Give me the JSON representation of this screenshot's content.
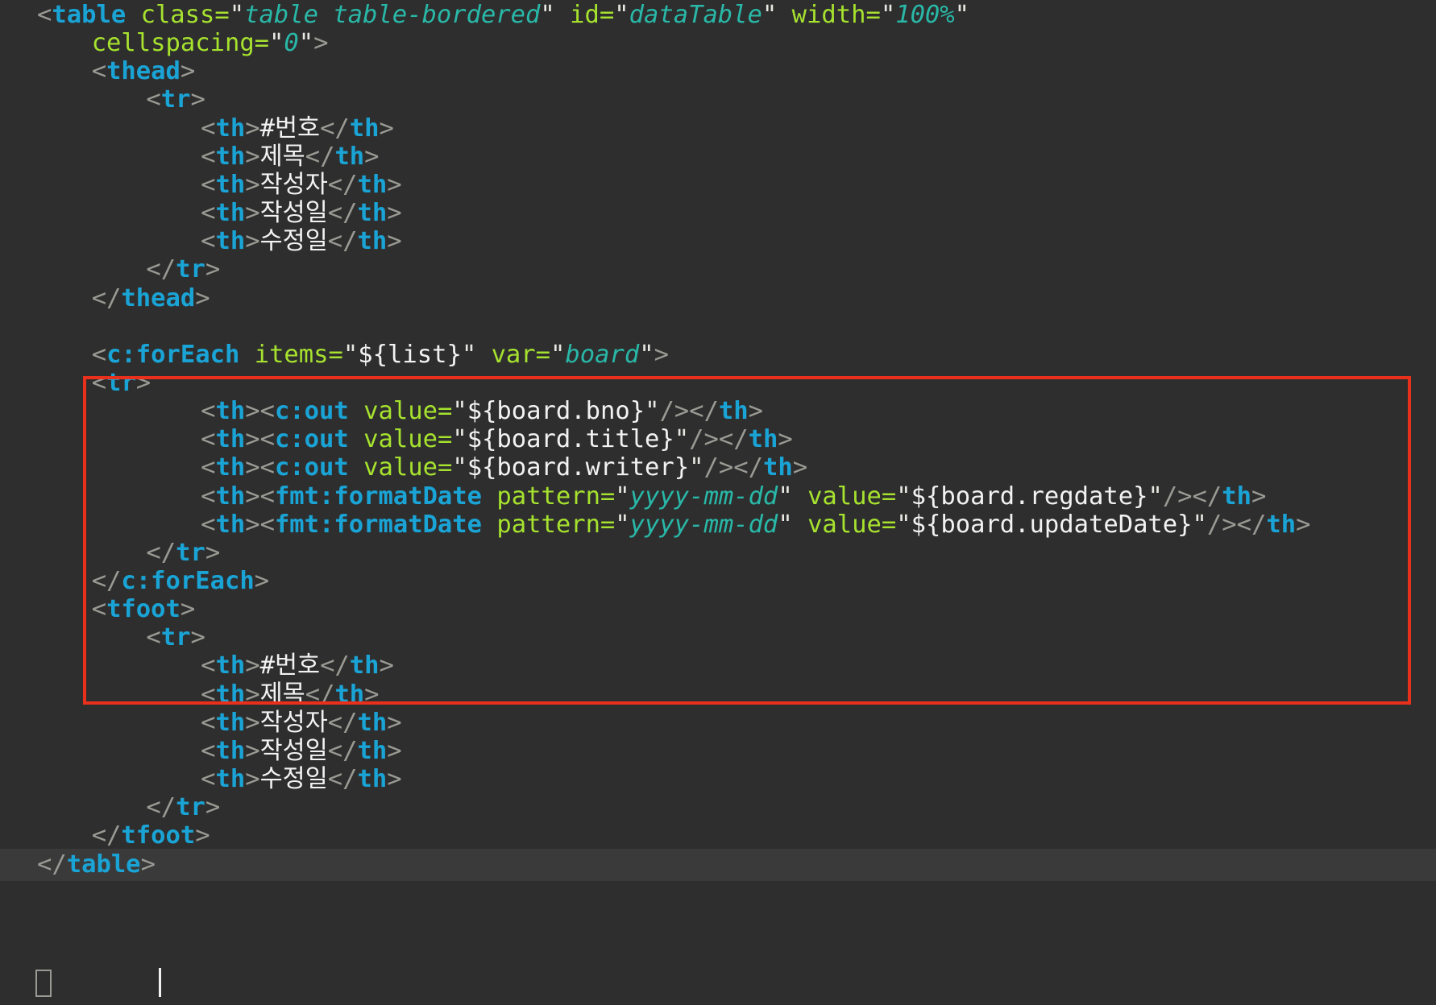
{
  "editor": {
    "language": "JSP / HTML",
    "colors": {
      "background": "#2e2e2e",
      "current_line": "#3a3a3a",
      "tag": "#1aa4d6",
      "attribute": "#a6e22e",
      "string": "#29b8a8",
      "punctuation": "#9a9a94",
      "text": "#f2f2f2",
      "highlight_box": "#e8301c"
    },
    "lines": [
      {
        "indent": 1,
        "tokens": [
          [
            "p",
            "<"
          ],
          [
            "t",
            "table"
          ],
          [
            "x",
            " "
          ],
          [
            "a",
            "class="
          ],
          [
            "q",
            "\""
          ],
          [
            "s",
            "table table-bordered"
          ],
          [
            "q",
            "\""
          ],
          [
            "x",
            " "
          ],
          [
            "a",
            "id="
          ],
          [
            "q",
            "\""
          ],
          [
            "s",
            "dataTable"
          ],
          [
            "q",
            "\""
          ],
          [
            "x",
            " "
          ],
          [
            "a",
            "width="
          ],
          [
            "q",
            "\""
          ],
          [
            "s",
            "100%"
          ],
          [
            "q",
            "\""
          ]
        ]
      },
      {
        "indent": 2,
        "tokens": [
          [
            "a",
            "cellspacing="
          ],
          [
            "q",
            "\""
          ],
          [
            "s",
            "0"
          ],
          [
            "q",
            "\""
          ],
          [
            "p",
            ">"
          ]
        ]
      },
      {
        "indent": 2,
        "tokens": [
          [
            "p",
            "<"
          ],
          [
            "t",
            "thead"
          ],
          [
            "p",
            ">"
          ]
        ]
      },
      {
        "indent": 3,
        "tokens": [
          [
            "p",
            "<"
          ],
          [
            "t",
            "tr"
          ],
          [
            "p",
            ">"
          ]
        ]
      },
      {
        "indent": 4,
        "tokens": [
          [
            "p",
            "<"
          ],
          [
            "t",
            "th"
          ],
          [
            "p",
            ">"
          ],
          [
            "x",
            "#번호"
          ],
          [
            "p",
            "</"
          ],
          [
            "t",
            "th"
          ],
          [
            "p",
            ">"
          ]
        ]
      },
      {
        "indent": 4,
        "tokens": [
          [
            "p",
            "<"
          ],
          [
            "t",
            "th"
          ],
          [
            "p",
            ">"
          ],
          [
            "x",
            "제목"
          ],
          [
            "p",
            "</"
          ],
          [
            "t",
            "th"
          ],
          [
            "p",
            ">"
          ]
        ]
      },
      {
        "indent": 4,
        "tokens": [
          [
            "p",
            "<"
          ],
          [
            "t",
            "th"
          ],
          [
            "p",
            ">"
          ],
          [
            "x",
            "작성자"
          ],
          [
            "p",
            "</"
          ],
          [
            "t",
            "th"
          ],
          [
            "p",
            ">"
          ]
        ]
      },
      {
        "indent": 4,
        "tokens": [
          [
            "p",
            "<"
          ],
          [
            "t",
            "th"
          ],
          [
            "p",
            ">"
          ],
          [
            "x",
            "작성일"
          ],
          [
            "p",
            "</"
          ],
          [
            "t",
            "th"
          ],
          [
            "p",
            ">"
          ]
        ]
      },
      {
        "indent": 4,
        "tokens": [
          [
            "p",
            "<"
          ],
          [
            "t",
            "th"
          ],
          [
            "p",
            ">"
          ],
          [
            "x",
            "수정일"
          ],
          [
            "p",
            "</"
          ],
          [
            "t",
            "th"
          ],
          [
            "p",
            ">"
          ]
        ]
      },
      {
        "indent": 3,
        "tokens": [
          [
            "p",
            "</"
          ],
          [
            "t",
            "tr"
          ],
          [
            "p",
            ">"
          ]
        ]
      },
      {
        "indent": 2,
        "tokens": [
          [
            "p",
            "</"
          ],
          [
            "t",
            "thead"
          ],
          [
            "p",
            ">"
          ]
        ]
      },
      {
        "indent": 0,
        "tokens": []
      },
      {
        "indent": 2,
        "tokens": [
          [
            "p",
            "<"
          ],
          [
            "t",
            "c:forEach"
          ],
          [
            "x",
            " "
          ],
          [
            "a",
            "items="
          ],
          [
            "q",
            "\""
          ],
          [
            "x",
            "${list}"
          ],
          [
            "q",
            "\""
          ],
          [
            "x",
            " "
          ],
          [
            "a",
            "var="
          ],
          [
            "q",
            "\""
          ],
          [
            "s",
            "board"
          ],
          [
            "q",
            "\""
          ],
          [
            "p",
            ">"
          ]
        ]
      },
      {
        "indent": 2,
        "tokens": [
          [
            "p",
            "<"
          ],
          [
            "t",
            "tr"
          ],
          [
            "p",
            ">"
          ]
        ]
      },
      {
        "indent": 4,
        "tokens": [
          [
            "p",
            "<"
          ],
          [
            "t",
            "th"
          ],
          [
            "p",
            "><"
          ],
          [
            "t",
            "c:out"
          ],
          [
            "x",
            " "
          ],
          [
            "a",
            "value="
          ],
          [
            "q",
            "\""
          ],
          [
            "x",
            "${board.bno}"
          ],
          [
            "q",
            "\""
          ],
          [
            "p",
            "/></"
          ],
          [
            "t",
            "th"
          ],
          [
            "p",
            ">"
          ]
        ]
      },
      {
        "indent": 4,
        "tokens": [
          [
            "p",
            "<"
          ],
          [
            "t",
            "th"
          ],
          [
            "p",
            "><"
          ],
          [
            "t",
            "c:out"
          ],
          [
            "x",
            " "
          ],
          [
            "a",
            "value="
          ],
          [
            "q",
            "\""
          ],
          [
            "x",
            "${board.title}"
          ],
          [
            "q",
            "\""
          ],
          [
            "p",
            "/></"
          ],
          [
            "t",
            "th"
          ],
          [
            "p",
            ">"
          ]
        ]
      },
      {
        "indent": 4,
        "tokens": [
          [
            "p",
            "<"
          ],
          [
            "t",
            "th"
          ],
          [
            "p",
            "><"
          ],
          [
            "t",
            "c:out"
          ],
          [
            "x",
            " "
          ],
          [
            "a",
            "value="
          ],
          [
            "q",
            "\""
          ],
          [
            "x",
            "${board.writer}"
          ],
          [
            "q",
            "\""
          ],
          [
            "p",
            "/></"
          ],
          [
            "t",
            "th"
          ],
          [
            "p",
            ">"
          ]
        ]
      },
      {
        "indent": 4,
        "tokens": [
          [
            "p",
            "<"
          ],
          [
            "t",
            "th"
          ],
          [
            "p",
            "><"
          ],
          [
            "t",
            "fmt:formatDate"
          ],
          [
            "x",
            " "
          ],
          [
            "a",
            "pattern="
          ],
          [
            "q",
            "\""
          ],
          [
            "s",
            "yyyy-mm-dd"
          ],
          [
            "q",
            "\""
          ],
          [
            "x",
            " "
          ],
          [
            "a",
            "value="
          ],
          [
            "q",
            "\""
          ],
          [
            "x",
            "${board.regdate}"
          ],
          [
            "q",
            "\""
          ],
          [
            "p",
            "/></"
          ],
          [
            "t",
            "th"
          ],
          [
            "p",
            ">"
          ]
        ]
      },
      {
        "indent": 4,
        "tokens": [
          [
            "p",
            "<"
          ],
          [
            "t",
            "th"
          ],
          [
            "p",
            "><"
          ],
          [
            "t",
            "fmt:formatDate"
          ],
          [
            "x",
            " "
          ],
          [
            "a",
            "pattern="
          ],
          [
            "q",
            "\""
          ],
          [
            "s",
            "yyyy-mm-dd"
          ],
          [
            "q",
            "\""
          ],
          [
            "x",
            " "
          ],
          [
            "a",
            "value="
          ],
          [
            "q",
            "\""
          ],
          [
            "x",
            "${board.updateDate}"
          ],
          [
            "q",
            "\""
          ],
          [
            "p",
            "/></"
          ],
          [
            "t",
            "th"
          ],
          [
            "p",
            ">"
          ]
        ]
      },
      {
        "indent": 3,
        "tokens": [
          [
            "p",
            "</"
          ],
          [
            "t",
            "tr"
          ],
          [
            "p",
            ">"
          ]
        ]
      },
      {
        "indent": 2,
        "tokens": [
          [
            "p",
            "</"
          ],
          [
            "t",
            "c:forEach"
          ],
          [
            "p",
            ">"
          ]
        ]
      },
      {
        "indent": 2,
        "tokens": [
          [
            "p",
            "<"
          ],
          [
            "t",
            "tfoot"
          ],
          [
            "p",
            ">"
          ]
        ]
      },
      {
        "indent": 3,
        "tokens": [
          [
            "p",
            "<"
          ],
          [
            "t",
            "tr"
          ],
          [
            "p",
            ">"
          ]
        ]
      },
      {
        "indent": 4,
        "tokens": [
          [
            "p",
            "<"
          ],
          [
            "t",
            "th"
          ],
          [
            "p",
            ">"
          ],
          [
            "x",
            "#번호"
          ],
          [
            "p",
            "</"
          ],
          [
            "t",
            "th"
          ],
          [
            "p",
            ">"
          ]
        ]
      },
      {
        "indent": 4,
        "tokens": [
          [
            "p",
            "<"
          ],
          [
            "t",
            "th"
          ],
          [
            "p",
            ">"
          ],
          [
            "x",
            "제목"
          ],
          [
            "p",
            "</"
          ],
          [
            "t",
            "th"
          ],
          [
            "p",
            ">"
          ]
        ]
      },
      {
        "indent": 4,
        "tokens": [
          [
            "p",
            "<"
          ],
          [
            "t",
            "th"
          ],
          [
            "p",
            ">"
          ],
          [
            "x",
            "작성자"
          ],
          [
            "p",
            "</"
          ],
          [
            "t",
            "th"
          ],
          [
            "p",
            ">"
          ]
        ]
      },
      {
        "indent": 4,
        "tokens": [
          [
            "p",
            "<"
          ],
          [
            "t",
            "th"
          ],
          [
            "p",
            ">"
          ],
          [
            "x",
            "작성일"
          ],
          [
            "p",
            "</"
          ],
          [
            "t",
            "th"
          ],
          [
            "p",
            ">"
          ]
        ]
      },
      {
        "indent": 4,
        "tokens": [
          [
            "p",
            "<"
          ],
          [
            "t",
            "th"
          ],
          [
            "p",
            ">"
          ],
          [
            "x",
            "수정일"
          ],
          [
            "p",
            "</"
          ],
          [
            "t",
            "th"
          ],
          [
            "p",
            ">"
          ]
        ]
      },
      {
        "indent": 3,
        "tokens": [
          [
            "p",
            "</"
          ],
          [
            "t",
            "tr"
          ],
          [
            "p",
            ">"
          ]
        ]
      },
      {
        "indent": 2,
        "tokens": [
          [
            "p",
            "</"
          ],
          [
            "t",
            "tfoot"
          ],
          [
            "p",
            ">"
          ]
        ]
      },
      {
        "indent": 1,
        "current": true,
        "tokens": [
          [
            "p",
            "</"
          ],
          [
            "t",
            "table"
          ],
          [
            "p",
            ">"
          ]
        ]
      }
    ]
  }
}
